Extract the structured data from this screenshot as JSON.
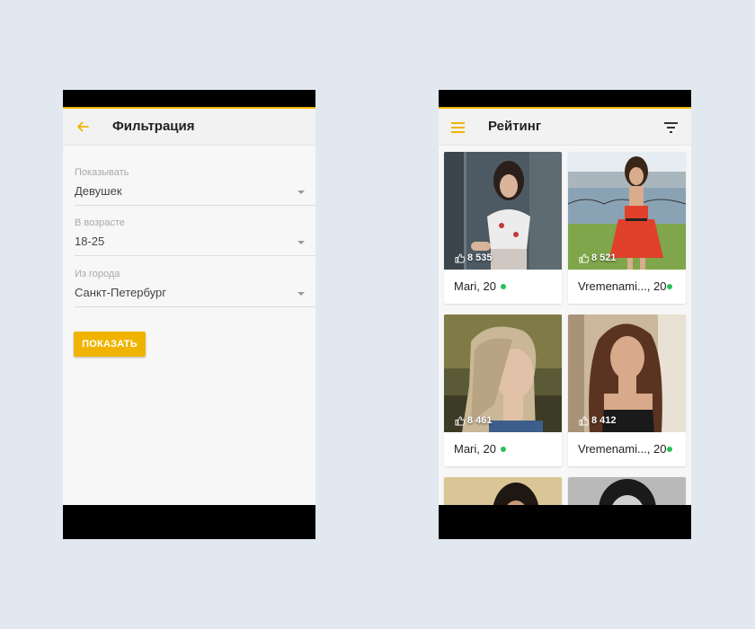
{
  "filter_screen": {
    "title": "Фильтрация",
    "fields": [
      {
        "label": "Показывать",
        "value": "Девушек"
      },
      {
        "label": "В возрасте",
        "value": "18-25"
      },
      {
        "label": "Из города",
        "value": "Санкт-Петербург"
      }
    ],
    "show_button": "ПОКАЗАТЬ",
    "accent_color": "#f0b400"
  },
  "rating_screen": {
    "title": "Рейтинг",
    "cards": [
      {
        "likes": "8 535",
        "name": "Mari, 20",
        "online": true
      },
      {
        "likes": "8 521",
        "name": "Vremenami..., 20",
        "online": true
      },
      {
        "likes": "8 461",
        "name": "Mari, 20",
        "online": true
      },
      {
        "likes": "8 412",
        "name": "Vremenami..., 20",
        "online": true
      }
    ],
    "online_color": "#29c15a"
  }
}
